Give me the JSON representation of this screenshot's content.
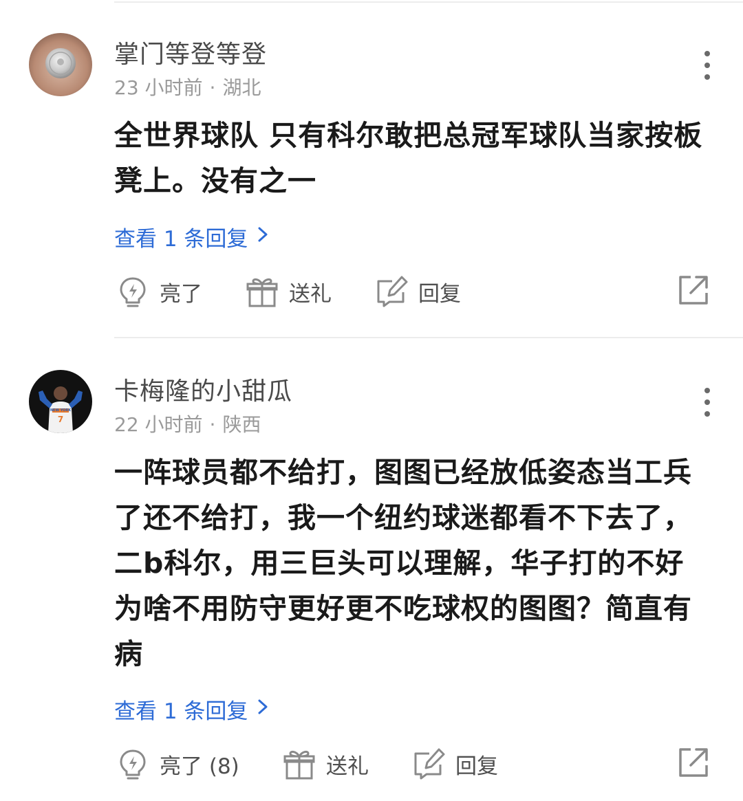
{
  "comments": [
    {
      "username": "掌门等登等登",
      "time": "23 小时前",
      "separator": "·",
      "location": "湖北",
      "text": "全世界球队 只有科尔敢把总冠军球队当家按板凳上。没有之一",
      "replies_label": "查看 1 条回复",
      "actions": {
        "like_label": "亮了",
        "gift_label": "送礼",
        "reply_label": "回复"
      }
    },
    {
      "username": "卡梅隆的小甜瓜",
      "time": "22 小时前",
      "separator": "·",
      "location": "陕西",
      "text": "一阵球员都不给打，图图已经放低姿态当工兵了还不给打，我一个纽约球迷都看不下去了，二b科尔，用三巨头可以理解，华子打的不好为啥不用防守更好更不吃球权的图图？简直有病",
      "replies_label": "查看 1 条回复",
      "avatar_jersey_text": "NEW YORK",
      "avatar_jersey_number": "7",
      "actions": {
        "like_label": "亮了 (8)",
        "gift_label": "送礼",
        "reply_label": "回复"
      }
    }
  ],
  "colors": {
    "link": "#2d6bd6",
    "body_text": "#1a1a1a",
    "meta_text": "#9a9a9a",
    "icon_stroke": "#8a8a8a",
    "divider": "#ececec"
  },
  "icons": {
    "more": "more-vertical-icon",
    "chevron": "chevron-right-icon",
    "like": "lightbulb-icon",
    "gift": "gift-icon",
    "reply": "edit-icon",
    "share": "share-icon"
  }
}
